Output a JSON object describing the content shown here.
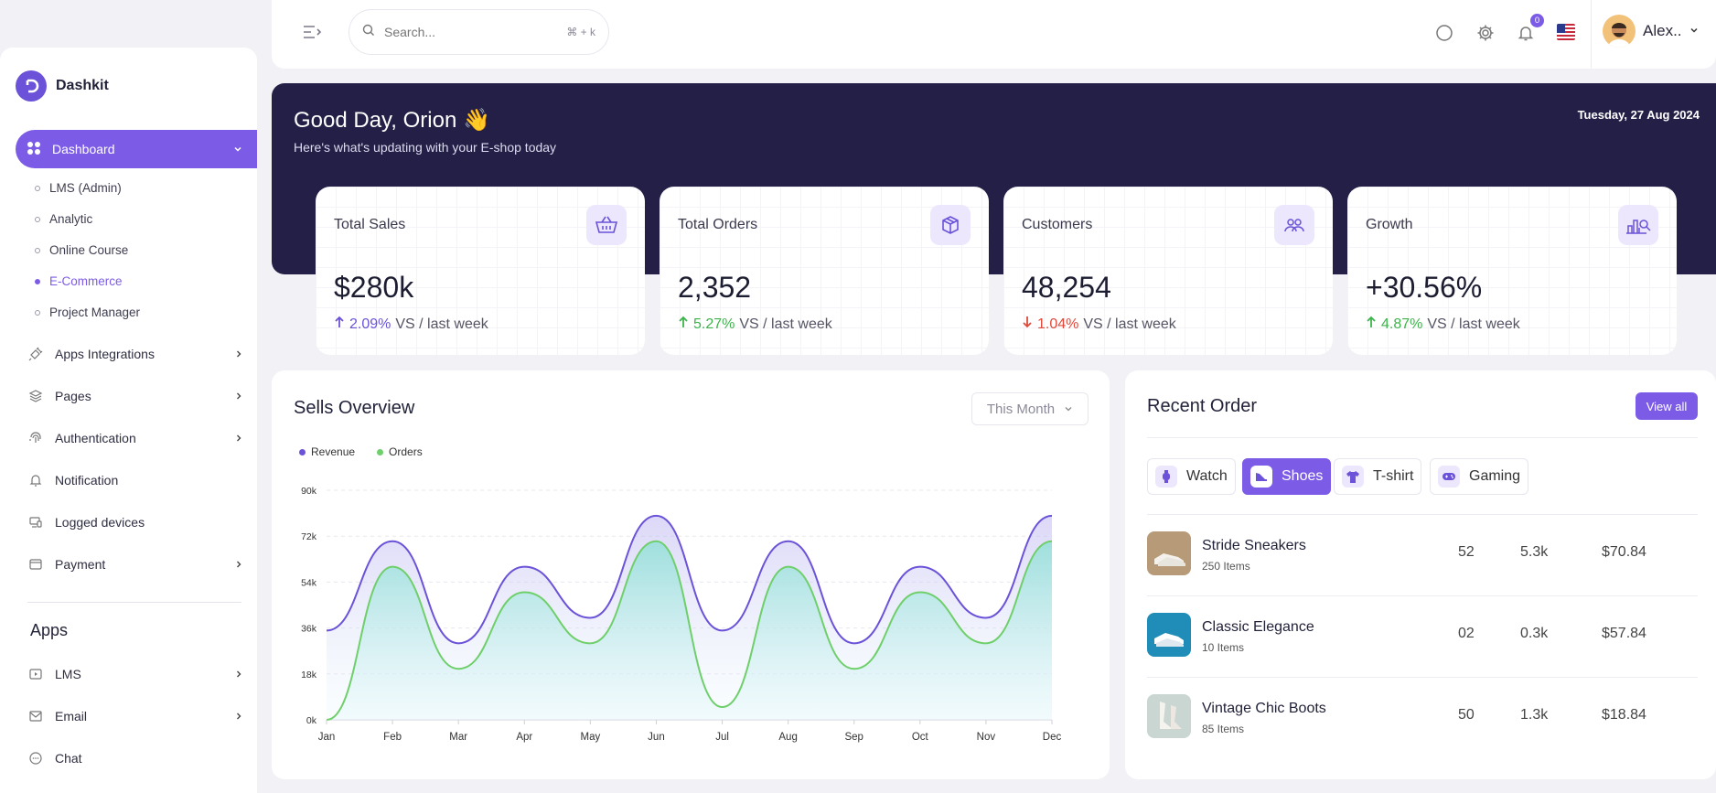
{
  "brand": {
    "name": "Dashkit"
  },
  "sidebar": {
    "dashboard_label": "Dashboard",
    "sub_items": [
      {
        "label": "LMS (Admin)"
      },
      {
        "label": "Analytic"
      },
      {
        "label": "Online Course"
      },
      {
        "label": "E-Commerce"
      },
      {
        "label": "Project Manager"
      }
    ],
    "active_sub_item": "E-Commerce",
    "items": [
      {
        "label": "Apps Integrations",
        "icon": "plug-icon"
      },
      {
        "label": "Pages",
        "icon": "layers-icon"
      },
      {
        "label": "Authentication",
        "icon": "fingerprint-icon"
      },
      {
        "label": "Notification",
        "icon": "bell-icon"
      },
      {
        "label": "Logged devices",
        "icon": "devices-icon"
      },
      {
        "label": "Payment",
        "icon": "wallet-icon"
      }
    ],
    "apps_title": "Apps",
    "apps": [
      {
        "label": "LMS",
        "icon": "video-icon"
      },
      {
        "label": "Email",
        "icon": "mail-icon"
      },
      {
        "label": "Chat",
        "icon": "chat-icon"
      }
    ]
  },
  "topbar": {
    "search_placeholder": "Search...",
    "search_shortcut": "⌘ + k",
    "notification_count": "0",
    "user_name": "Alex.."
  },
  "hero": {
    "greeting": "Good Day, Orion 👋",
    "subtitle": "Here's what's updating with your E-shop today",
    "date": "Tuesday, 27 Aug 2024"
  },
  "stats": [
    {
      "title": "Total Sales",
      "value": "$280k",
      "change": "2.09%",
      "suffix": "VS / last week",
      "direction": "up",
      "color": "#6b52d8",
      "icon": "basket-icon"
    },
    {
      "title": "Total Orders",
      "value": "2,352",
      "change": "5.27%",
      "suffix": "VS / last week",
      "direction": "up",
      "color": "#3cb44b",
      "icon": "box-icon"
    },
    {
      "title": "Customers",
      "value": "48,254",
      "change": "1.04%",
      "suffix": "VS / last week",
      "direction": "down",
      "color": "#e0483b",
      "icon": "users-icon"
    },
    {
      "title": "Growth",
      "value": "+30.56%",
      "change": "4.87%",
      "suffix": "VS / last week",
      "direction": "up",
      "color": "#3cb44b",
      "icon": "chart-search-icon"
    }
  ],
  "sells": {
    "title": "Sells Overview",
    "period": "This Month"
  },
  "chart_data": {
    "type": "area",
    "title": "Sells Overview",
    "categories": [
      "Jan",
      "Feb",
      "Mar",
      "Apr",
      "May",
      "Jun",
      "Jul",
      "Aug",
      "Sep",
      "Oct",
      "Nov",
      "Dec"
    ],
    "series": [
      {
        "name": "Revenue",
        "color": "#6b52d8",
        "values": [
          35,
          70,
          30,
          60,
          40,
          80,
          35,
          70,
          30,
          60,
          40,
          80
        ]
      },
      {
        "name": "Orders",
        "color": "#6fcf6a",
        "values": [
          0,
          60,
          20,
          50,
          30,
          70,
          5,
          60,
          20,
          50,
          30,
          70
        ]
      }
    ],
    "y_ticks": [
      "0k",
      "18k",
      "36k",
      "54k",
      "72k",
      "90k"
    ],
    "ylim": [
      0,
      90
    ],
    "y_unit": "k",
    "legend_position": "top-left",
    "grid": true
  },
  "recent": {
    "title": "Recent Order",
    "view_all": "View all",
    "tabs": [
      {
        "label": "Watch",
        "icon": "watch-icon",
        "active": false
      },
      {
        "label": "Shoes",
        "icon": "shoe-icon",
        "active": true
      },
      {
        "label": "T-shirt",
        "icon": "tshirt-icon",
        "active": false
      },
      {
        "label": "Gaming",
        "icon": "gamepad-icon",
        "active": false
      }
    ],
    "rows": [
      {
        "name": "Stride Sneakers",
        "items": "250 Items",
        "qty": "52",
        "sold": "5.3k",
        "price": "$70.84"
      },
      {
        "name": "Classic Elegance",
        "items": "10 Items",
        "qty": "02",
        "sold": "0.3k",
        "price": "$57.84"
      },
      {
        "name": "Vintage Chic Boots",
        "items": "85 Items",
        "qty": "50",
        "sold": "1.3k",
        "price": "$18.84"
      }
    ]
  }
}
